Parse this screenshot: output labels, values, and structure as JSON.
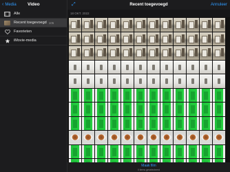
{
  "sidebar": {
    "back_label": "Media",
    "title": "Video",
    "items": [
      {
        "label": "Alle",
        "icon": "film-icon",
        "count": ""
      },
      {
        "label": "Recent toegevoegd",
        "icon": "thumbnail-icon",
        "count": "105"
      },
      {
        "label": "Favorieten",
        "icon": "heart-icon",
        "count": ""
      },
      {
        "label": "iMovie-media",
        "icon": "star-icon",
        "count": ""
      }
    ]
  },
  "main": {
    "title": "Recent toegevoegd",
    "cancel_label": "Annuleer",
    "date_header": "18 OKT. 2022",
    "bottom": {
      "make_film_label": "Maak film",
      "subtitle": "0 items geselecteerd"
    }
  },
  "grid_rows": [
    [
      "room",
      "room",
      "room",
      "room",
      "room",
      "room",
      "room",
      "room",
      "room",
      "room",
      "room",
      "room"
    ],
    [
      "room",
      "room",
      "room",
      "room",
      "room",
      "room",
      "room",
      "room",
      "room",
      "room",
      "room",
      "room"
    ],
    [
      "room",
      "room",
      "room",
      "room",
      "room",
      "room",
      "room",
      "room",
      "room",
      "room",
      "room",
      "room"
    ],
    [
      "white",
      "white",
      "white",
      "white",
      "white",
      "white",
      "white",
      "white",
      "white",
      "white",
      "white",
      "white"
    ],
    [
      "white",
      "white",
      "white",
      "white",
      "white",
      "white",
      "white",
      "white",
      "white",
      "white",
      "white",
      "white"
    ],
    [
      "green",
      "green",
      "green",
      "green",
      "green",
      "green",
      "green",
      "green",
      "green",
      "green",
      "green",
      "green"
    ],
    [
      "green",
      "green",
      "green",
      "green",
      "green",
      "green",
      "green",
      "green",
      "green",
      "green",
      "green",
      "green"
    ],
    [
      "green",
      "green",
      "green",
      "green",
      "green",
      "green",
      "green",
      "green",
      "green",
      "green",
      "green",
      "green"
    ],
    [
      "plate",
      "plate",
      "plate",
      "plate",
      "plate",
      "plate",
      "plate",
      "plate",
      "plate",
      "plate",
      "plate",
      "plate"
    ],
    [
      "green",
      "green",
      "green",
      "green",
      "green",
      "green",
      "green",
      "green",
      "green",
      "green",
      "green",
      "green"
    ],
    [
      "green",
      "green",
      "green",
      "green",
      "green",
      "green",
      "green",
      "green",
      "green",
      "green",
      "green",
      "green"
    ]
  ],
  "colors": {
    "accent": "#2f9bff",
    "sidebar_bg": "#1c1c1e",
    "selected_bg": "#3a3a3c"
  }
}
